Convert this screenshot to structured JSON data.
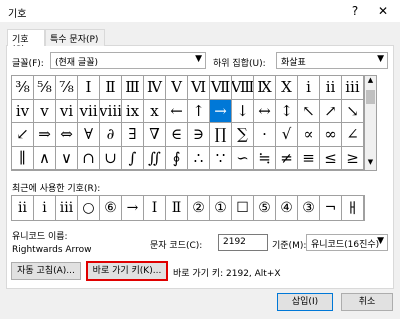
{
  "window": {
    "title": "기호",
    "help": "?",
    "close": "✕"
  },
  "tabs": [
    {
      "label": "기호(S)"
    },
    {
      "label": "특수 문자(P)"
    }
  ],
  "font_row": {
    "font_label": "글꼴(F):",
    "font_value": "(현재 글꼴)",
    "subset_label": "하위 집합(U):",
    "subset_value": "화살표"
  },
  "symbols": [
    "⅜",
    "⅝",
    "⅞",
    "Ⅰ",
    "Ⅱ",
    "Ⅲ",
    "Ⅳ",
    "Ⅴ",
    "Ⅵ",
    "Ⅶ",
    "Ⅷ",
    "Ⅸ",
    "Ⅹ",
    "ⅰ",
    "ⅱ",
    "ⅲ",
    "ⅳ",
    "ⅴ",
    "ⅵ",
    "ⅶ",
    "ⅷ",
    "ⅸ",
    "ⅹ",
    "←",
    "↑",
    "→",
    "↓",
    "↔",
    "↕",
    "↖",
    "↗",
    "↘",
    "↙",
    "⇒",
    "⇔",
    "∀",
    "∂",
    "∃",
    "∇",
    "∈",
    "∋",
    "∏",
    "∑",
    "·",
    "√",
    "∝",
    "∞",
    "∠",
    "∥",
    "∧",
    "∨",
    "∩",
    "∪",
    "∫",
    "∬",
    "∮",
    "∴",
    "∵",
    "∽",
    "≒",
    "≠",
    "≡",
    "≤",
    "≥"
  ],
  "selected_index": 25,
  "recent": {
    "label": "최근에 사용한 기호(R):",
    "symbols": [
      "ⅱ",
      "ⅰ",
      "ⅲ",
      "○",
      "⑥",
      "→",
      "Ⅰ",
      "Ⅱ",
      "②",
      "①",
      "☐",
      "⑤",
      "④",
      "③",
      "¬",
      "ㅐ"
    ]
  },
  "unicode": {
    "name_label": "유니코드 이름:",
    "name_value": "Rightwards Arrow",
    "code_label": "문자 코드(C):",
    "code_value": "2192",
    "from_label": "기준(M):",
    "from_value": "유니코드(16진수)"
  },
  "buttons": {
    "autocorrect": "자동 고침(A)...",
    "shortcut": "바로 가기 키(K)...",
    "shortcut_text": "바로 가기 키: 2192, Alt+X",
    "insert": "삽입(I)",
    "cancel": "취소"
  }
}
